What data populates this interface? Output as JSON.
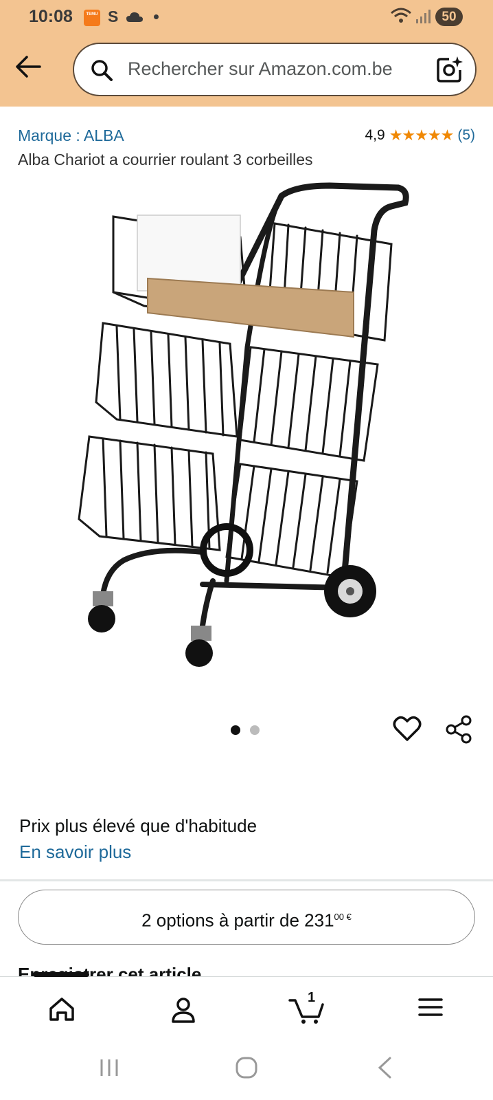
{
  "status_bar": {
    "time": "10:08",
    "app_badge": "TEMU",
    "s_indicator": "S",
    "battery": "50",
    "icons": [
      "temu-icon",
      "s-icon",
      "cloud-icon",
      "dot-icon",
      "wifi-icon",
      "signal-icon",
      "battery-icon"
    ]
  },
  "header": {
    "search_placeholder": "Rechercher sur Amazon.com.be",
    "icons": [
      "back-arrow-icon",
      "search-icon",
      "camera-lens-icon"
    ],
    "colors": {
      "header_bg": "#f3c491"
    }
  },
  "product": {
    "brand": "Marque : ALBA",
    "rating_value": "4,9",
    "stars": "★★★★★",
    "rating_count": "(5)",
    "title": "Alba Chariot a courrier roulant 3 corbeilles",
    "image_page": 1,
    "image_count": 2,
    "colors": {
      "link": "#1f6a9a",
      "stars": "#f08804"
    }
  },
  "price_info": {
    "note": "Prix plus élevé que d'habitude",
    "learn_more": "En savoir plus"
  },
  "offers": {
    "label": "2 options à partir de 231",
    "cents": "00 €"
  },
  "save_section": {
    "label": "Enregistrer cet article"
  },
  "bottom_nav": {
    "cart_count": "1",
    "icons": [
      "home-icon",
      "account-icon",
      "cart-icon",
      "menu-icon"
    ]
  },
  "system_nav": {
    "icons": [
      "recents-icon",
      "home-circle-icon",
      "back-chevron-icon"
    ]
  }
}
